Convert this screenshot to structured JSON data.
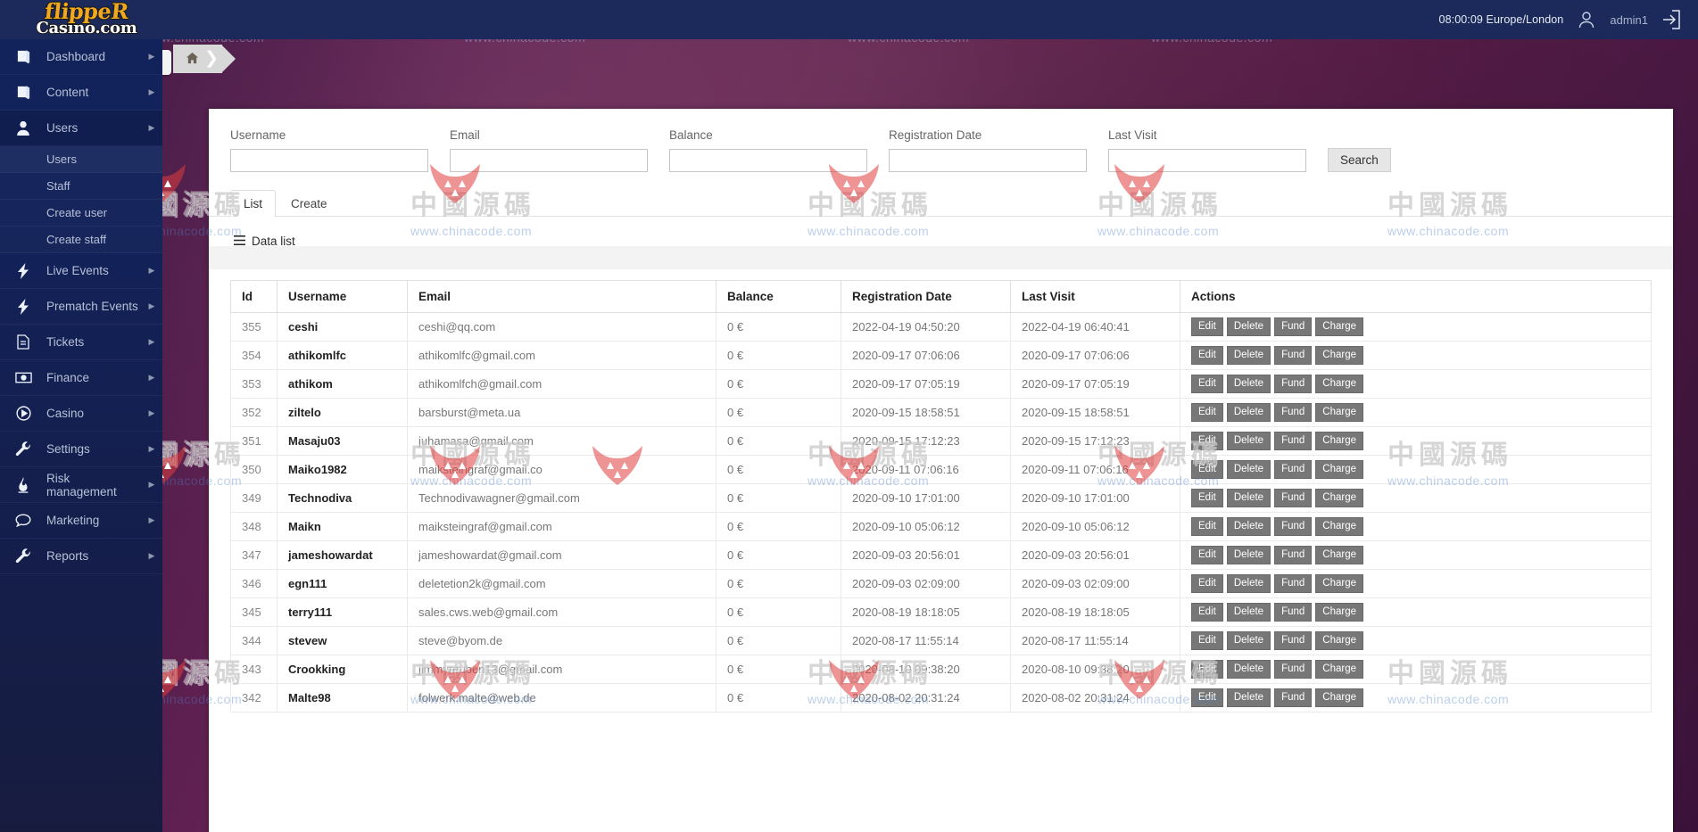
{
  "brand": {
    "logo_line1": "flippeR",
    "logo_line2": "Casino.com",
    "accent": "#f0a81e"
  },
  "header": {
    "clock": "08:00:09 Europe/London",
    "username": "admin1",
    "avatar_icon": "user-avatar-icon",
    "logout_icon": "logout-icon"
  },
  "breadcrumb": {
    "home_icon": "home-icon"
  },
  "sidebar": {
    "collapse_icon": "chevron-left-icon",
    "items": [
      {
        "label": "Dashboard",
        "icon": "book-icon",
        "caret": true,
        "sub": false
      },
      {
        "label": "Content",
        "icon": "book-icon",
        "caret": true,
        "sub": false
      },
      {
        "label": "Users",
        "icon": "user-icon",
        "caret": true,
        "sub": false,
        "open": true
      },
      {
        "label": "Users",
        "icon": "",
        "caret": false,
        "sub": true,
        "active": true
      },
      {
        "label": "Staff",
        "icon": "",
        "caret": false,
        "sub": true
      },
      {
        "label": "Create user",
        "icon": "",
        "caret": false,
        "sub": true
      },
      {
        "label": "Create staff",
        "icon": "",
        "caret": false,
        "sub": true
      },
      {
        "label": "Live Events",
        "icon": "bolt-icon",
        "caret": true,
        "sub": false
      },
      {
        "label": "Prematch Events",
        "icon": "bolt-icon",
        "caret": true,
        "sub": false
      },
      {
        "label": "Tickets",
        "icon": "file-icon",
        "caret": true,
        "sub": false
      },
      {
        "label": "Finance",
        "icon": "money-icon",
        "caret": true,
        "sub": false
      },
      {
        "label": "Casino",
        "icon": "play-circle-icon",
        "caret": true,
        "sub": false
      },
      {
        "label": "Settings",
        "icon": "wrench-icon",
        "caret": true,
        "sub": false
      },
      {
        "label": "Risk management",
        "icon": "fire-icon",
        "caret": true,
        "sub": false
      },
      {
        "label": "Marketing",
        "icon": "chat-icon",
        "caret": true,
        "sub": false
      },
      {
        "label": "Reports",
        "icon": "wrench-icon",
        "caret": true,
        "sub": false
      }
    ]
  },
  "search": {
    "fields": [
      {
        "label": "Username",
        "value": "",
        "placeholder": ""
      },
      {
        "label": "Email",
        "value": "",
        "placeholder": ""
      },
      {
        "label": "Balance",
        "value": "",
        "placeholder": ""
      },
      {
        "label": "Registration Date",
        "value": "",
        "placeholder": ""
      },
      {
        "label": "Last Visit",
        "value": "",
        "placeholder": ""
      }
    ],
    "button_label": "Search"
  },
  "tabs": [
    {
      "label": "List",
      "active": true
    },
    {
      "label": "Create",
      "active": false
    }
  ],
  "datalist": {
    "title": "Data list",
    "icon": "list-icon"
  },
  "table": {
    "columns": [
      "Id",
      "Username",
      "Email",
      "Balance",
      "Registration Date",
      "Last Visit",
      "Actions"
    ],
    "actions": [
      "Edit",
      "Delete",
      "Fund",
      "Charge"
    ],
    "rows": [
      {
        "id": "355",
        "username": "ceshi",
        "email": "ceshi@qq.com",
        "balance": "0 €",
        "registration_date": "2022-04-19 04:50:20",
        "last_visit": "2022-04-19 06:40:41"
      },
      {
        "id": "354",
        "username": "athikomlfc",
        "email": "athikomlfc@gmail.com",
        "balance": "0 €",
        "registration_date": "2020-09-17 07:06:06",
        "last_visit": "2020-09-17 07:06:06"
      },
      {
        "id": "353",
        "username": "athikom",
        "email": "athikomlfch@gmail.com",
        "balance": "0 €",
        "registration_date": "2020-09-17 07:05:19",
        "last_visit": "2020-09-17 07:05:19"
      },
      {
        "id": "352",
        "username": "ziltelo",
        "email": "barsburst@meta.ua",
        "balance": "0 €",
        "registration_date": "2020-09-15 18:58:51",
        "last_visit": "2020-09-15 18:58:51"
      },
      {
        "id": "351",
        "username": "Masaju03",
        "email": "juhamasa@gmail.com",
        "balance": "0 €",
        "registration_date": "2020-09-15 17:12:23",
        "last_visit": "2020-09-15 17:12:23"
      },
      {
        "id": "350",
        "username": "Maiko1982",
        "email": "maiksteingraf@gmail.co",
        "balance": "0 €",
        "registration_date": "2020-09-11 07:06:16",
        "last_visit": "2020-09-11 07:06:16"
      },
      {
        "id": "349",
        "username": "Technodiva",
        "email": "Technodivawagner@gmail.com",
        "balance": "0 €",
        "registration_date": "2020-09-10 17:01:00",
        "last_visit": "2020-09-10 17:01:00"
      },
      {
        "id": "348",
        "username": "Maikn",
        "email": "maiksteingraf@gmail.com",
        "balance": "0 €",
        "registration_date": "2020-09-10 05:06:12",
        "last_visit": "2020-09-10 05:06:12"
      },
      {
        "id": "347",
        "username": "jameshowardat",
        "email": "jameshowardat@gmail.com",
        "balance": "0 €",
        "registration_date": "2020-09-03 20:56:01",
        "last_visit": "2020-09-03 20:56:01"
      },
      {
        "id": "346",
        "username": "egn111",
        "email": "deletetion2k@gmail.com",
        "balance": "0 €",
        "registration_date": "2020-09-03 02:09:00",
        "last_visit": "2020-09-03 02:09:00"
      },
      {
        "id": "345",
        "username": "terry111",
        "email": "sales.cws.web@gmail.com",
        "balance": "0 €",
        "registration_date": "2020-08-19 18:18:05",
        "last_visit": "2020-08-19 18:18:05"
      },
      {
        "id": "344",
        "username": "stevew",
        "email": "steve@byom.de",
        "balance": "0 €",
        "registration_date": "2020-08-17 11:55:14",
        "last_visit": "2020-08-17 11:55:14"
      },
      {
        "id": "343",
        "username": "Crookking",
        "email": "jimmyreuben13@gmail.com",
        "balance": "0 €",
        "registration_date": "2020-08-10 09:38:20",
        "last_visit": "2020-08-10 09:38:20"
      },
      {
        "id": "342",
        "username": "Malte98",
        "email": "folwerk.malte@web.de",
        "balance": "0 €",
        "registration_date": "2020-08-02 20:31:24",
        "last_visit": "2020-08-02 20:31:24"
      }
    ]
  },
  "watermark": {
    "cn_text": "中國源碼",
    "url_text": "www.chinacode.com"
  }
}
